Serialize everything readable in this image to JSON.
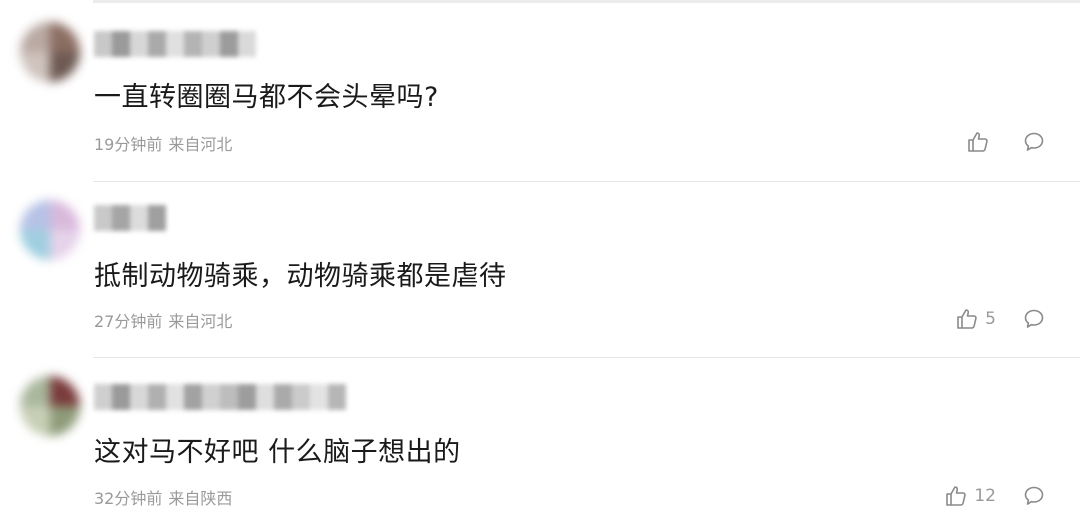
{
  "comments": [
    {
      "text": "一直转圈圈马都不会头晕吗?",
      "time": "19分钟前",
      "location": "来自河北",
      "likes": "",
      "avatar_colors": [
        "#b9a9a2",
        "#8c6e62",
        "#cfc3bd",
        "#6e5a53"
      ],
      "username_colors": [
        "#c8c8c8",
        "#9a9a9a",
        "#d7d7d7",
        "#aaaaaa",
        "#e0e0e0",
        "#b4b4b4",
        "#cfcfcf",
        "#9c9c9c",
        "#dadada"
      ]
    },
    {
      "text": "抵制动物骑乘，动物骑乘都是虐待",
      "time": "27分钟前",
      "location": "来自河北",
      "likes": "5",
      "avatar_colors": [
        "#b6c2e6",
        "#d9b9dc",
        "#9fcfe0",
        "#e6d3ea"
      ],
      "username_colors": [
        "#c9c9c9",
        "#a5a5a5",
        "#dcdcdc",
        "#9f9f9f"
      ]
    },
    {
      "text": "这对马不好吧 什么脑子想出的",
      "time": "32分钟前",
      "location": "来自陕西",
      "likes": "12",
      "avatar_colors": [
        "#a9b79c",
        "#7a3b3b",
        "#c8cfb6",
        "#8e9c7a"
      ],
      "username_colors": [
        "#cfcfcf",
        "#9a9a9a",
        "#d8d8d8",
        "#b0b0b0",
        "#e1e1e1",
        "#a2a2a2",
        "#d0d0d0",
        "#bdbdbd",
        "#9d9d9d",
        "#dedede",
        "#aaaaaa",
        "#cbcbcb",
        "#e3e3e3",
        "#b6b6b6"
      ]
    }
  ]
}
